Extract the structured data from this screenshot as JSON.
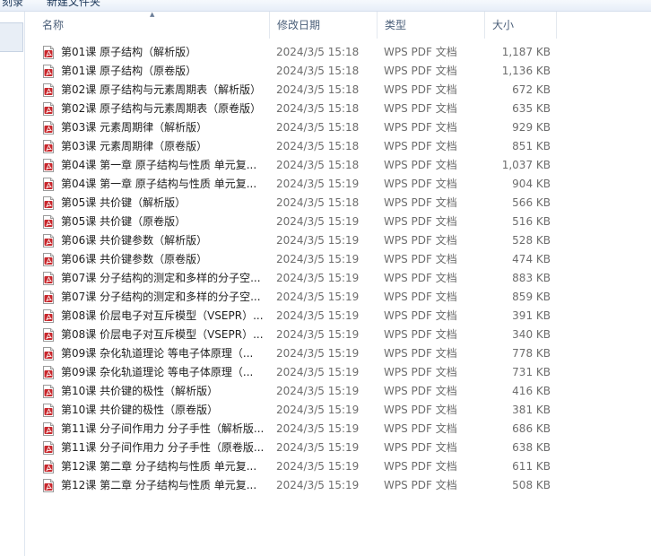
{
  "toolbar": {
    "items": [
      "刻录",
      "新建文件夹"
    ]
  },
  "header": {
    "name": "名称",
    "date": "修改日期",
    "type": "类型",
    "size": "大小"
  },
  "files": [
    {
      "name": "第01课  原子结构（解析版）",
      "date": "2024/3/5 15:18",
      "type": "WPS PDF 文档",
      "size": "1,187 KB"
    },
    {
      "name": "第01课  原子结构（原卷版）",
      "date": "2024/3/5 15:18",
      "type": "WPS PDF 文档",
      "size": "1,136 KB"
    },
    {
      "name": "第02课  原子结构与元素周期表（解析版）",
      "date": "2024/3/5 15:18",
      "type": "WPS PDF 文档",
      "size": "672 KB"
    },
    {
      "name": "第02课  原子结构与元素周期表（原卷版）",
      "date": "2024/3/5 15:18",
      "type": "WPS PDF 文档",
      "size": "635 KB"
    },
    {
      "name": "第03课 元素周期律（解析版）",
      "date": "2024/3/5 15:18",
      "type": "WPS PDF 文档",
      "size": "929 KB"
    },
    {
      "name": "第03课 元素周期律（原卷版）",
      "date": "2024/3/5 15:18",
      "type": "WPS PDF 文档",
      "size": "851 KB"
    },
    {
      "name": "第04课 第一章 原子结构与性质 单元复...",
      "date": "2024/3/5 15:18",
      "type": "WPS PDF 文档",
      "size": "1,037 KB"
    },
    {
      "name": "第04课 第一章 原子结构与性质 单元复...",
      "date": "2024/3/5 15:19",
      "type": "WPS PDF 文档",
      "size": "904 KB"
    },
    {
      "name": "第05课  共价键（解析版）",
      "date": "2024/3/5 15:18",
      "type": "WPS PDF 文档",
      "size": "566 KB"
    },
    {
      "name": "第05课  共价键（原卷版）",
      "date": "2024/3/5 15:19",
      "type": "WPS PDF 文档",
      "size": "516 KB"
    },
    {
      "name": "第06课  共价键参数（解析版）",
      "date": "2024/3/5 15:19",
      "type": "WPS PDF 文档",
      "size": "528 KB"
    },
    {
      "name": "第06课  共价键参数（原卷版）",
      "date": "2024/3/5 15:19",
      "type": "WPS PDF 文档",
      "size": "474 KB"
    },
    {
      "name": "第07课 分子结构的测定和多样的分子空...",
      "date": "2024/3/5 15:19",
      "type": "WPS PDF 文档",
      "size": "883 KB"
    },
    {
      "name": "第07课 分子结构的测定和多样的分子空...",
      "date": "2024/3/5 15:19",
      "type": "WPS PDF 文档",
      "size": "859 KB"
    },
    {
      "name": "第08课 价层电子对互斥模型（VSEPR）...",
      "date": "2024/3/5 15:19",
      "type": "WPS PDF 文档",
      "size": "391 KB"
    },
    {
      "name": "第08课 价层电子对互斥模型（VSEPR）...",
      "date": "2024/3/5 15:19",
      "type": "WPS PDF 文档",
      "size": "340 KB"
    },
    {
      "name": "第09课 杂化轨道理论  等电子体原理（...",
      "date": "2024/3/5 15:19",
      "type": "WPS PDF 文档",
      "size": "778 KB"
    },
    {
      "name": "第09课 杂化轨道理论  等电子体原理（...",
      "date": "2024/3/5 15:19",
      "type": "WPS PDF 文档",
      "size": "731 KB"
    },
    {
      "name": "第10课 共价键的极性（解析版）",
      "date": "2024/3/5 15:19",
      "type": "WPS PDF 文档",
      "size": "416 KB"
    },
    {
      "name": "第10课 共价键的极性（原卷版）",
      "date": "2024/3/5 15:19",
      "type": "WPS PDF 文档",
      "size": "381 KB"
    },
    {
      "name": "第11课 分子间作用力 分子手性（解析版...",
      "date": "2024/3/5 15:19",
      "type": "WPS PDF 文档",
      "size": "686 KB"
    },
    {
      "name": "第11课 分子间作用力 分子手性（原卷版...",
      "date": "2024/3/5 15:19",
      "type": "WPS PDF 文档",
      "size": "638 KB"
    },
    {
      "name": "第12课 第二章 分子结构与性质 单元复...",
      "date": "2024/3/5 15:19",
      "type": "WPS PDF 文档",
      "size": "611 KB"
    },
    {
      "name": "第12课 第二章 分子结构与性质 单元复...",
      "date": "2024/3/5 15:19",
      "type": "WPS PDF 文档",
      "size": "508 KB"
    }
  ],
  "icons": {
    "file": "pdf-file-icon",
    "sort": "sort-ascending-icon"
  },
  "colors": {
    "pdf_red": "#c8262b",
    "header_text": "#4c607a",
    "meta_text": "#6d6d6d"
  }
}
